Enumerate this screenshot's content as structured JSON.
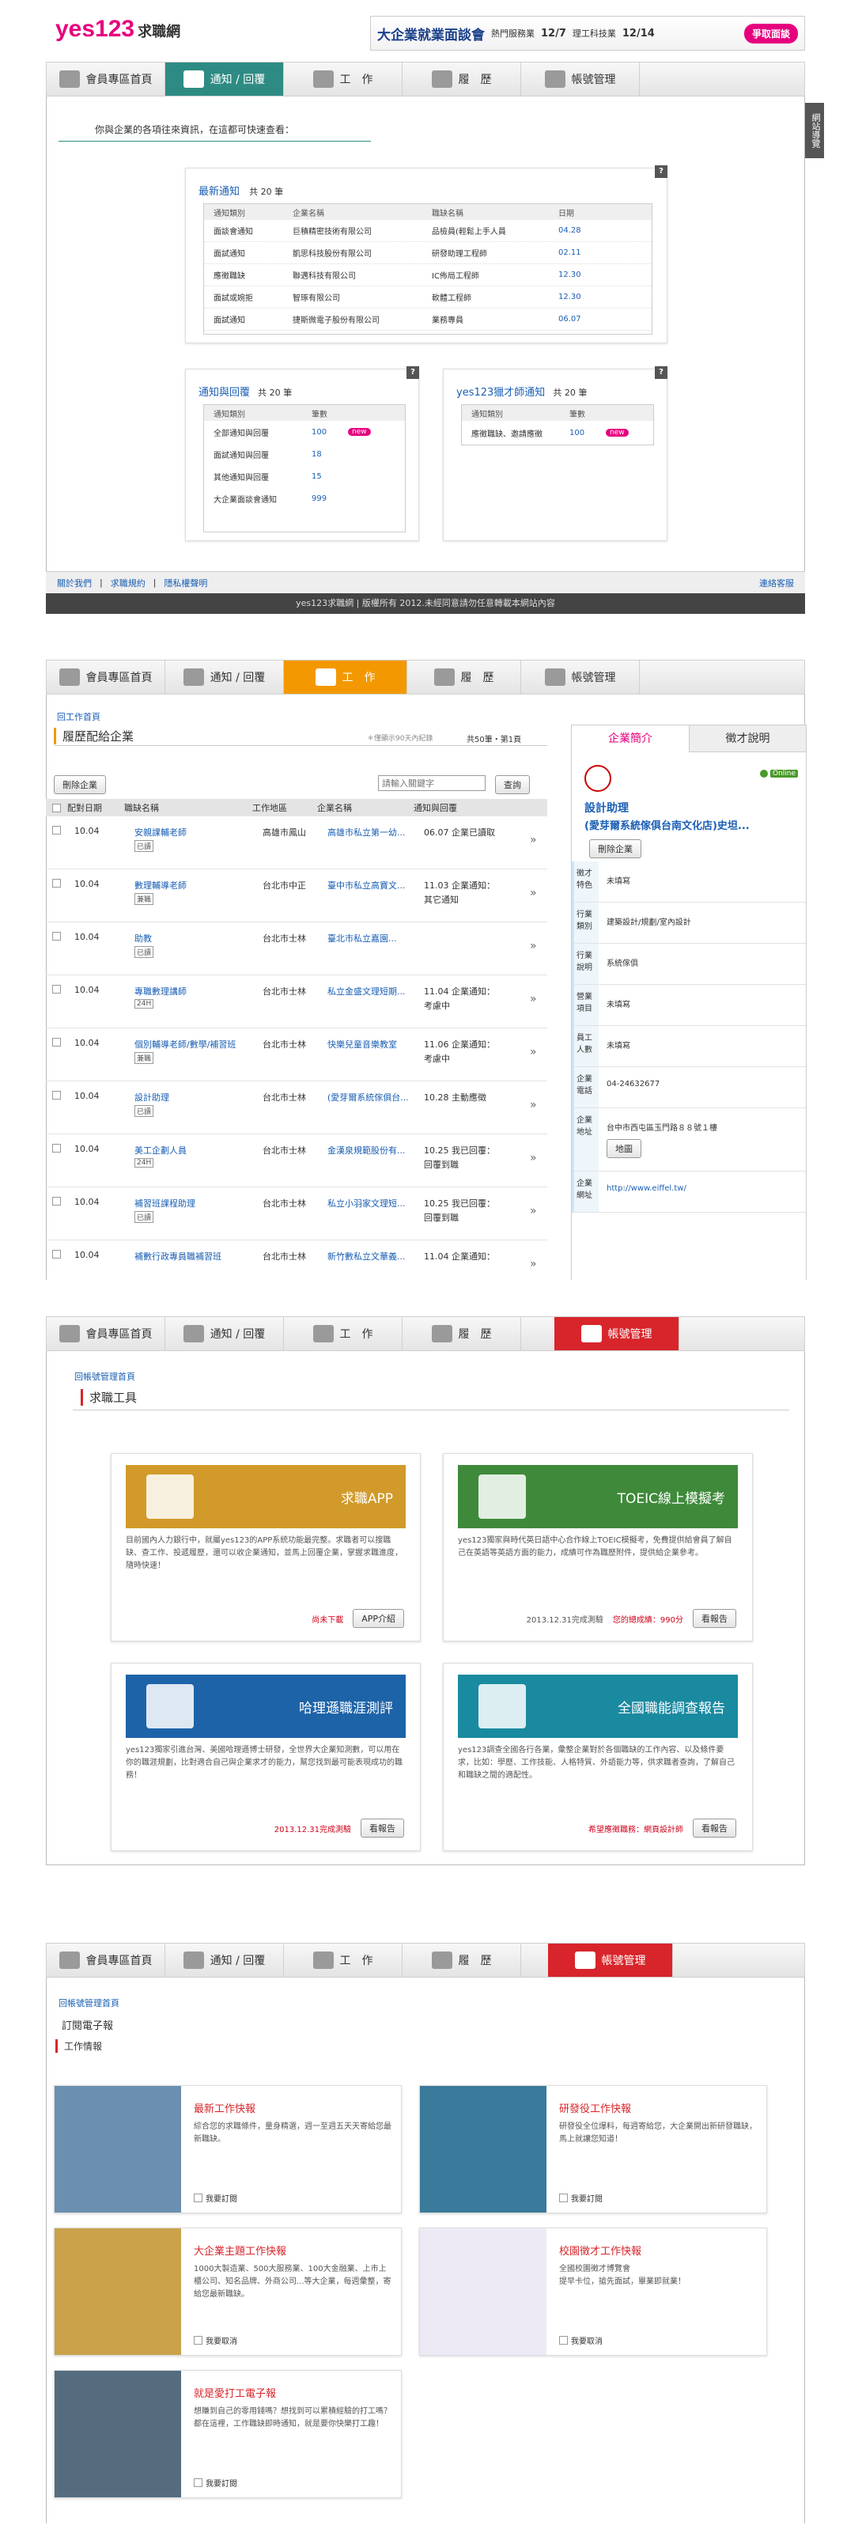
{
  "logo": {
    "brand": "yes123",
    "suffix": "求職網"
  },
  "banner": {
    "title": "大企業就業面談會",
    "text1": "熱門服務業",
    "date1": "12/7",
    "text2": "理工科技業",
    "date2": "12/14",
    "cta": "爭取面談"
  },
  "nav_tabs": [
    "會員專區首頁",
    "通知 / 回覆",
    "工　作",
    "履　歷",
    "帳號管理"
  ],
  "s1": {
    "intro": "你與企業的各項往來資訊，在這都可快速查看：",
    "side_tab": "網站導覽",
    "latest": {
      "title": "最新通知",
      "count": "共 20 筆",
      "headers": [
        "通知類別",
        "企業名稱",
        "職缺名稱",
        "日期"
      ],
      "rows": [
        [
          "面談會通知",
          "巨積精密技術有限公司",
          "品檢員(輕鬆上手人員",
          "04.28"
        ],
        [
          "面試通知",
          "凱思科技股份有限公司",
          "研發助理工程師",
          "02.11"
        ],
        [
          "應徵職缺",
          "聯邁科技有限公司",
          "IC佈局工程師",
          "12.30"
        ],
        [
          "面試或婉拒",
          "智琢有限公司",
          "軟體工程師",
          "12.30"
        ],
        [
          "面試通知",
          "捷斯微電子股份有限公司",
          "業務專員",
          "06.07"
        ]
      ]
    },
    "notify": {
      "title": "通知與回覆",
      "count": "共 20 筆",
      "headers": [
        "通知類別",
        "筆數"
      ],
      "rows": [
        [
          "全部通知與回覆",
          "100",
          "new"
        ],
        [
          "面試通知與回覆",
          "18",
          ""
        ],
        [
          "其他通知與回覆",
          "15",
          ""
        ],
        [
          "大企業面談會通知",
          "999",
          ""
        ]
      ]
    },
    "hunter": {
      "title": "yes123獵才師通知",
      "count": "共 20 筆",
      "headers": [
        "通知類別",
        "筆數"
      ],
      "rows": [
        [
          "應徵職缺、邀請應徵",
          "100",
          "new"
        ]
      ]
    },
    "footer_links": [
      "關於我們",
      "求職規約",
      "隱私權聲明"
    ],
    "footer_right": "連絡客服",
    "copyright": "yes123求職網 | 版權所有 2012.未經同意請勿任意轉載本網站內容"
  },
  "s2": {
    "back": "回工作首頁",
    "title": "履歷配給企業",
    "note": "＊僅顯示90天內紀錄",
    "count": "共50筆・第1頁",
    "del_btn": "刪除企業",
    "search_ph": "請輸入關鍵字",
    "search_btn": "查詢",
    "headers": [
      "配對日期",
      "職缺名稱",
      "工作地區",
      "企業名稱",
      "通知與回覆"
    ],
    "rows": [
      [
        "10.04",
        "安親課輔老師",
        "已讀",
        "高雄市鳳山",
        "高雄市私立第一幼...",
        "06.07 企業已讀取",
        ""
      ],
      [
        "10.04",
        "數理輔導老師",
        "兼職",
        "台北市中正",
        "臺中市私立高寶文...",
        "11.03 企業通知：",
        "其它通知"
      ],
      [
        "10.04",
        "助教",
        "已讀",
        "台北市士林",
        "臺北市私立嘉園...",
        "",
        ""
      ],
      [
        "10.04",
        "專職數理講師",
        "24H",
        "台北市士林",
        "私立金盛文理短期...",
        "11.04 企業通知：",
        "考慮中"
      ],
      [
        "10.04",
        "個別輔導老師/數學/補習班",
        "兼職",
        "台北市士林",
        "快樂兒童音樂教室",
        "11.06 企業通知：",
        "考慮中"
      ],
      [
        "10.04",
        "設計助理",
        "已讀",
        "台北市士林",
        "(愛芽爾系統傢俱台...",
        "10.28 主動應徵",
        ""
      ],
      [
        "10.04",
        "美工企劃人員",
        "24H",
        "台北市士林",
        "金漢泉規範股份有...",
        "10.25 我已回覆：",
        "回覆到職"
      ],
      [
        "10.04",
        "補習班課程助理",
        "已讀",
        "台北市士林",
        "私立小羽家文理短...",
        "10.25 我已回覆：",
        "回覆到職"
      ],
      [
        "10.04",
        "補數行政專員職補習班",
        "",
        "台北市士林",
        "新竹數私立文華義...",
        "11.04 企業通知：",
        ""
      ]
    ],
    "panel": {
      "tabs": [
        "企業簡介",
        "徵才說明"
      ],
      "online": "Online",
      "name": "設計助理",
      "company": "(愛芽爾系統傢俱台南文化店)史坦...",
      "del": "刪除企業",
      "fields": [
        [
          "徵才特色",
          "未填寫"
        ],
        [
          "行業類別",
          "建築設計/規劃/室內設計"
        ],
        [
          "行業說明",
          "系統傢俱"
        ],
        [
          "營業項目",
          "未填寫"
        ],
        [
          "員工人數",
          "未填寫"
        ],
        [
          "企業電話",
          "04-24632677"
        ],
        [
          "企業地址",
          "台中市西屯區玉門路８８號１樓"
        ],
        [
          "企業網址",
          "http://www.eiffel.tw/"
        ]
      ],
      "map_btn": "地圖"
    }
  },
  "s3": {
    "back": "回帳號管理首頁",
    "title": "求職工具",
    "cards": [
      {
        "banner": "求職APP",
        "text": "目前國內人力銀行中，就屬yes123的APP系統功能最完整。求職者可以搜職缺、查工作、投遞履歷，還可以收企業通知，並馬上回覆企業，掌握求職進度，隨時快速！",
        "status": "尚未下載",
        "btn": "APP介紹",
        "bg": "#d19a2a"
      },
      {
        "banner": "TOEIC線上模擬考",
        "text": "yes123獨家與時代英日語中心合作線上TOEIC模擬考，免費提供給會員了解自己在英語等英語方面的能力，成績可作為職歷附件，提供給企業參考。",
        "status": "2013.12.31完成測驗",
        "status2": "您的總成績：990分",
        "btn": "看報告",
        "bg": "#3f8a3a"
      },
      {
        "banner": "哈理遜職涯測評",
        "text": "yes123獨家引進台灣、美國哈理遜博士研發，全世界大企業知測數，可以用在你的職涯規劃，比對適合自己與企業求才的能力，幫您找到最可能表現成功的職務！",
        "status": "2013.12.31完成測驗",
        "btn": "看報告",
        "bg": "#1d63a8"
      },
      {
        "banner": "全國職能調查報告",
        "text": "yes123調查全國各行各業，彙整企業對於各個職缺的工作內容、以及條件要求，比如：學歷、工作技能、人格特質、外語能力等，供求職者查詢，了解自己和職缺之間的適配性。",
        "status": "希望應徵職務：網頁設計師",
        "btn": "看報告",
        "bg": "#1a8aa0"
      }
    ]
  },
  "s4": {
    "back": "回帳號管理首頁",
    "title": "訂閱電子報",
    "subtitle": "工作情報",
    "cards": [
      {
        "title": "最新工作快報",
        "text": "綜合您的求職條件，量身精選，週一至週五天天寄給您最新職缺。",
        "check": "我要訂閱"
      },
      {
        "title": "研發役工作快報",
        "text": "研發役全位爆料，每週寄給您，大企業開出新研發職缺，馬上就讓您知道！",
        "check": "我要訂閱"
      },
      {
        "title": "大企業主題工作快報",
        "text": "1000大製造業、500大服務業、100大金融業、上市上櫃公司、知名品牌、外商公司...等大企業，每週彙整，寄給您最新職缺。",
        "check": "我要取消"
      },
      {
        "title": "校園徵才工作快報",
        "text": "全國校園徵才博覽會\n提早卡位，搶先面試，畢業即就業！",
        "check": "我要取消"
      },
      {
        "title": "就是愛打工電子報",
        "text": "想賺到自己的零用錢嗎？想找到可以累積經驗的打工嗎？都在這裡，工作職缺即時通知，就是要你快樂打工趣！",
        "check": "我要訂閱"
      }
    ]
  },
  "colors": {
    "accent": "#2e8b84",
    "brand": "#e6007e",
    "orange": "#f39800",
    "red": "#d7252b"
  }
}
